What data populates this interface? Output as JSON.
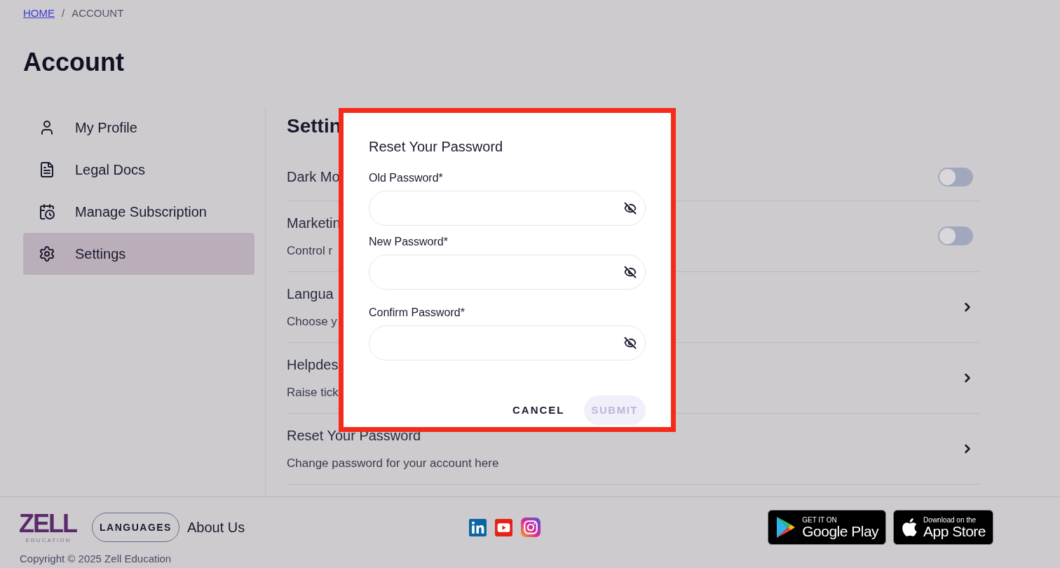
{
  "breadcrumb": {
    "home": "HOME",
    "separator": "/",
    "current": "ACCOUNT"
  },
  "page_title": "Account",
  "sidebar": {
    "items": [
      {
        "label": "My Profile",
        "selected": false
      },
      {
        "label": "Legal Docs",
        "selected": false
      },
      {
        "label": "Manage Subscription",
        "selected": false
      },
      {
        "label": "Settings",
        "selected": true
      }
    ]
  },
  "settings": {
    "title": "Settin",
    "rows": [
      {
        "kind": "toggle",
        "title": "Dark Mo",
        "on": false
      },
      {
        "kind": "toggle",
        "title": "Marketin",
        "subtitle": "Control r",
        "on": false
      },
      {
        "kind": "link",
        "title": "Langua",
        "subtitle": "Choose y"
      },
      {
        "kind": "link",
        "title": "Helpdes",
        "subtitle": "Raise tick"
      },
      {
        "kind": "link",
        "title": "Reset Your Password",
        "subtitle": "Change password for your account here"
      }
    ]
  },
  "dialog": {
    "title": "Reset Your Password",
    "fields": [
      {
        "label": "Old Password*"
      },
      {
        "label": "New Password*"
      },
      {
        "label": "Confirm Password*"
      }
    ],
    "cancel": "CANCEL",
    "submit": {
      "label": "SUBMIT",
      "disabled": true
    }
  },
  "footer": {
    "logo": {
      "word": "ZELL",
      "tagline": "EDUCATION"
    },
    "languages_button": "LANGUAGES",
    "about_link": "About Us",
    "stores": [
      {
        "kind": "google",
        "small": "GET IT ON",
        "big": "Google Play"
      },
      {
        "kind": "apple",
        "small": "Download on the",
        "big": "App Store"
      }
    ],
    "copyright": "Copyright © 2025 Zell Education"
  }
}
